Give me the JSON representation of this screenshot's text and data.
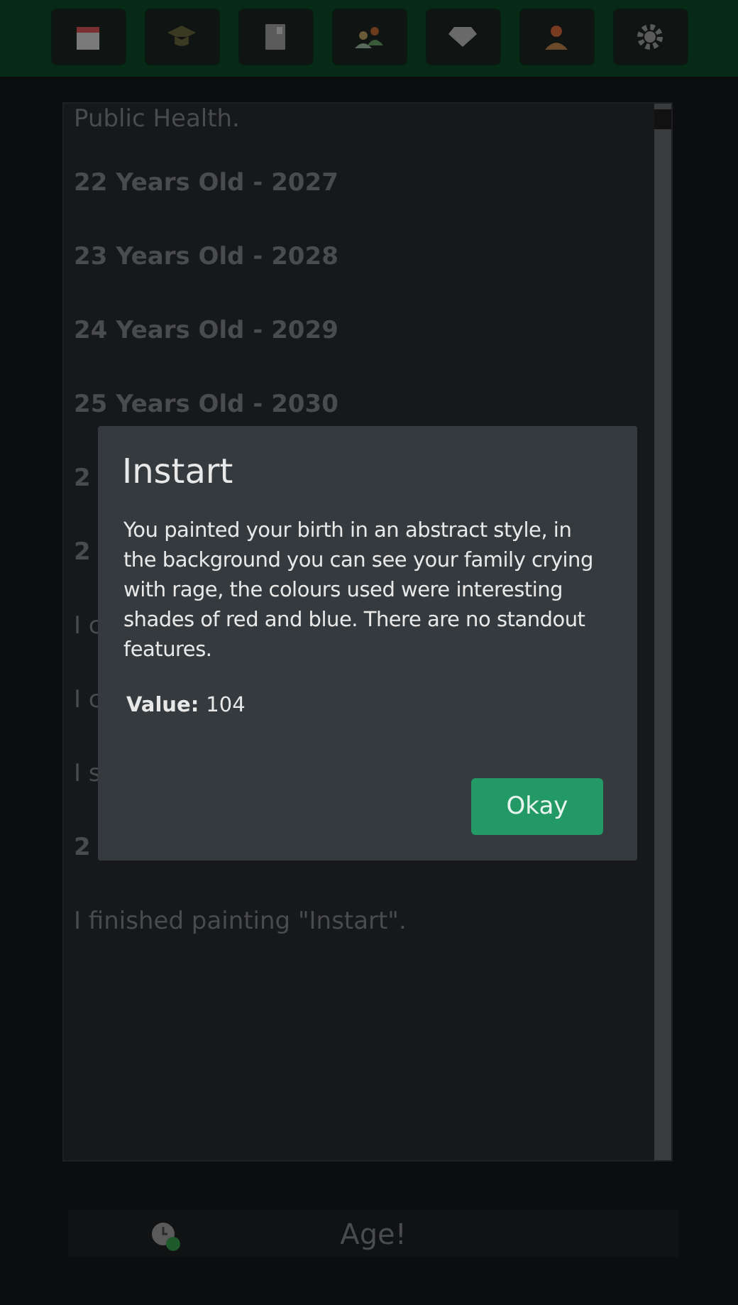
{
  "toolbar": [
    {
      "kind": "calendar"
    },
    {
      "kind": "cap"
    },
    {
      "kind": "book"
    },
    {
      "kind": "people"
    },
    {
      "kind": "diamond"
    },
    {
      "kind": "person"
    },
    {
      "kind": "gear"
    }
  ],
  "log": [
    {
      "kind": "text",
      "text": "Public Health."
    },
    {
      "kind": "heading",
      "text": "22 Years Old  - 2027"
    },
    {
      "kind": "heading",
      "text": "23 Years Old  - 2028"
    },
    {
      "kind": "heading",
      "text": "24 Years Old  - 2029"
    },
    {
      "kind": "heading",
      "text": "25 Years Old  - 2030"
    },
    {
      "kind": "heading",
      "text": "2"
    },
    {
      "kind": "heading",
      "text": "2"
    },
    {
      "kind": "text",
      "text": "I c"
    },
    {
      "kind": "text",
      "text": "I c"
    },
    {
      "kind": "text",
      "text": "I s"
    },
    {
      "kind": "heading",
      "text": "2"
    },
    {
      "kind": "text",
      "text": "I finished painting \"Instart\"."
    }
  ],
  "dialog": {
    "title": "Instart",
    "body": "You painted your birth in an abstract style, in the background you can see your family crying with rage, the colours used were interesting shades of red and blue. There are no standout features.",
    "value_label": "Value:",
    "value": "104",
    "button": "Okay"
  },
  "age_button": {
    "label": "Age!"
  }
}
